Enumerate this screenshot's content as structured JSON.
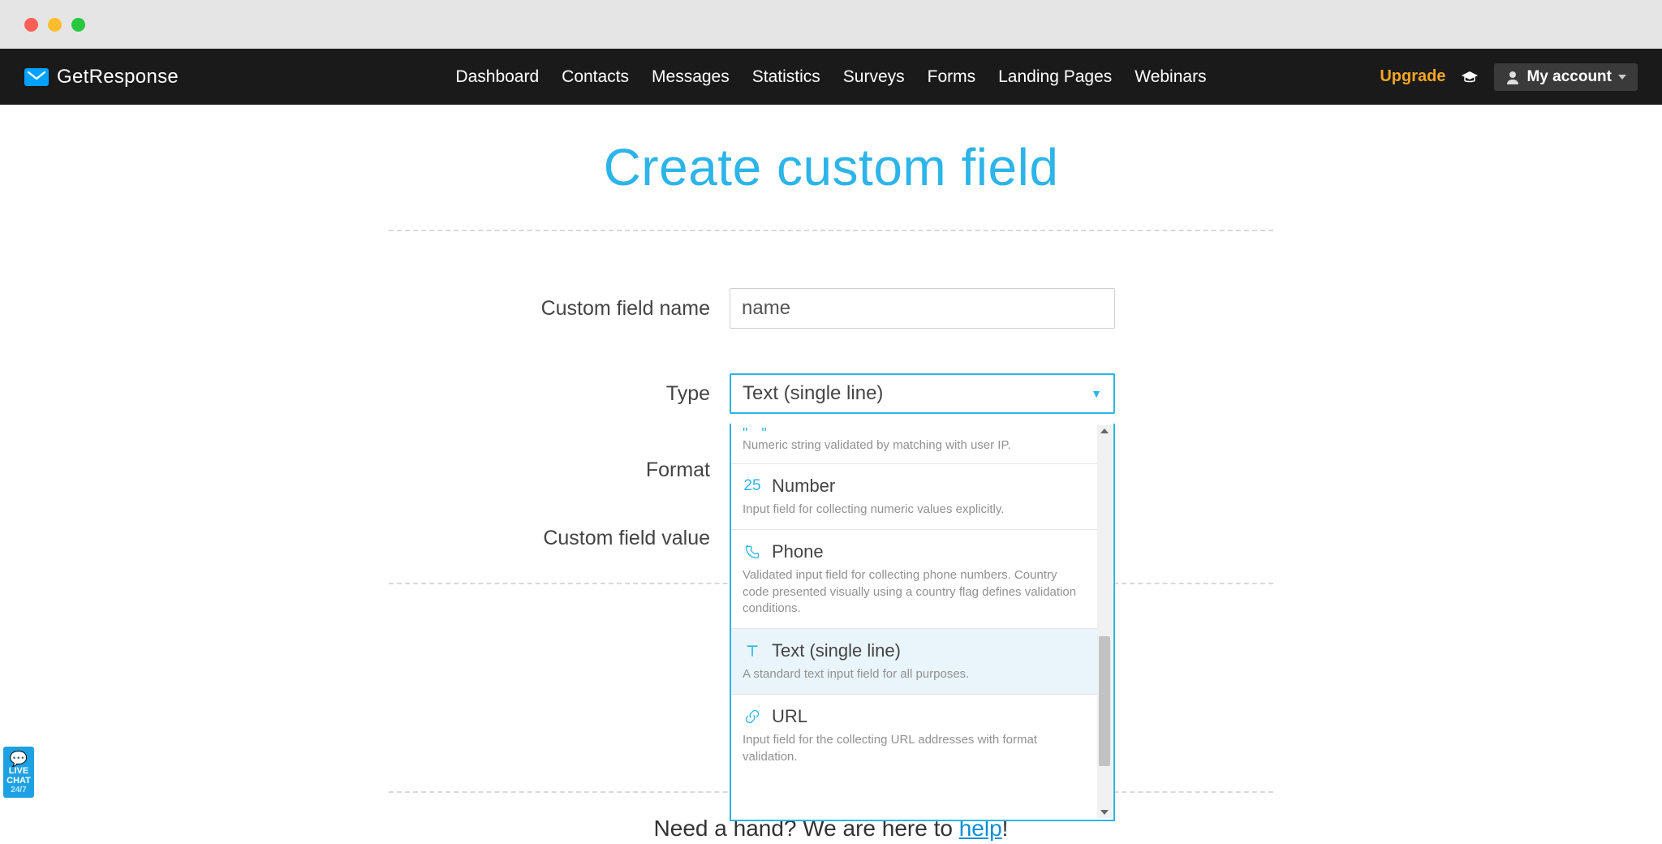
{
  "brand": {
    "name": "GetResponse"
  },
  "nav": {
    "items": [
      "Dashboard",
      "Contacts",
      "Messages",
      "Statistics",
      "Surveys",
      "Forms",
      "Landing Pages",
      "Webinars"
    ]
  },
  "header_right": {
    "upgrade": "Upgrade",
    "account": "My account"
  },
  "page": {
    "title": "Create custom field",
    "labels": {
      "name": "Custom field name",
      "type": "Type",
      "format": "Format",
      "value": "Custom field value"
    },
    "name_value": "name",
    "type_selected": "Text (single line)"
  },
  "dropdown": {
    "top_hint": "Numeric string validated by matching with user IP.",
    "items": [
      {
        "icon": "number",
        "label": "Number",
        "desc": "Input field for collecting numeric values explicitly.",
        "selected": false
      },
      {
        "icon": "phone",
        "label": "Phone",
        "desc": "Validated input field for collecting phone numbers. Country code presented visually using a country flag defines validation conditions.",
        "selected": false
      },
      {
        "icon": "text",
        "label": "Text (single line)",
        "desc": "A standard text input field for all purposes.",
        "selected": true
      },
      {
        "icon": "url",
        "label": "URL",
        "desc": "Input field for the collecting URL addresses with format validation.",
        "selected": false
      }
    ],
    "number_glyph": "25"
  },
  "help": {
    "prefix": "Need a hand? We are here to ",
    "link": "help",
    "suffix": "!"
  },
  "chat": {
    "line1": "LIVE",
    "line2": "CHAT",
    "line3": "24/7"
  }
}
